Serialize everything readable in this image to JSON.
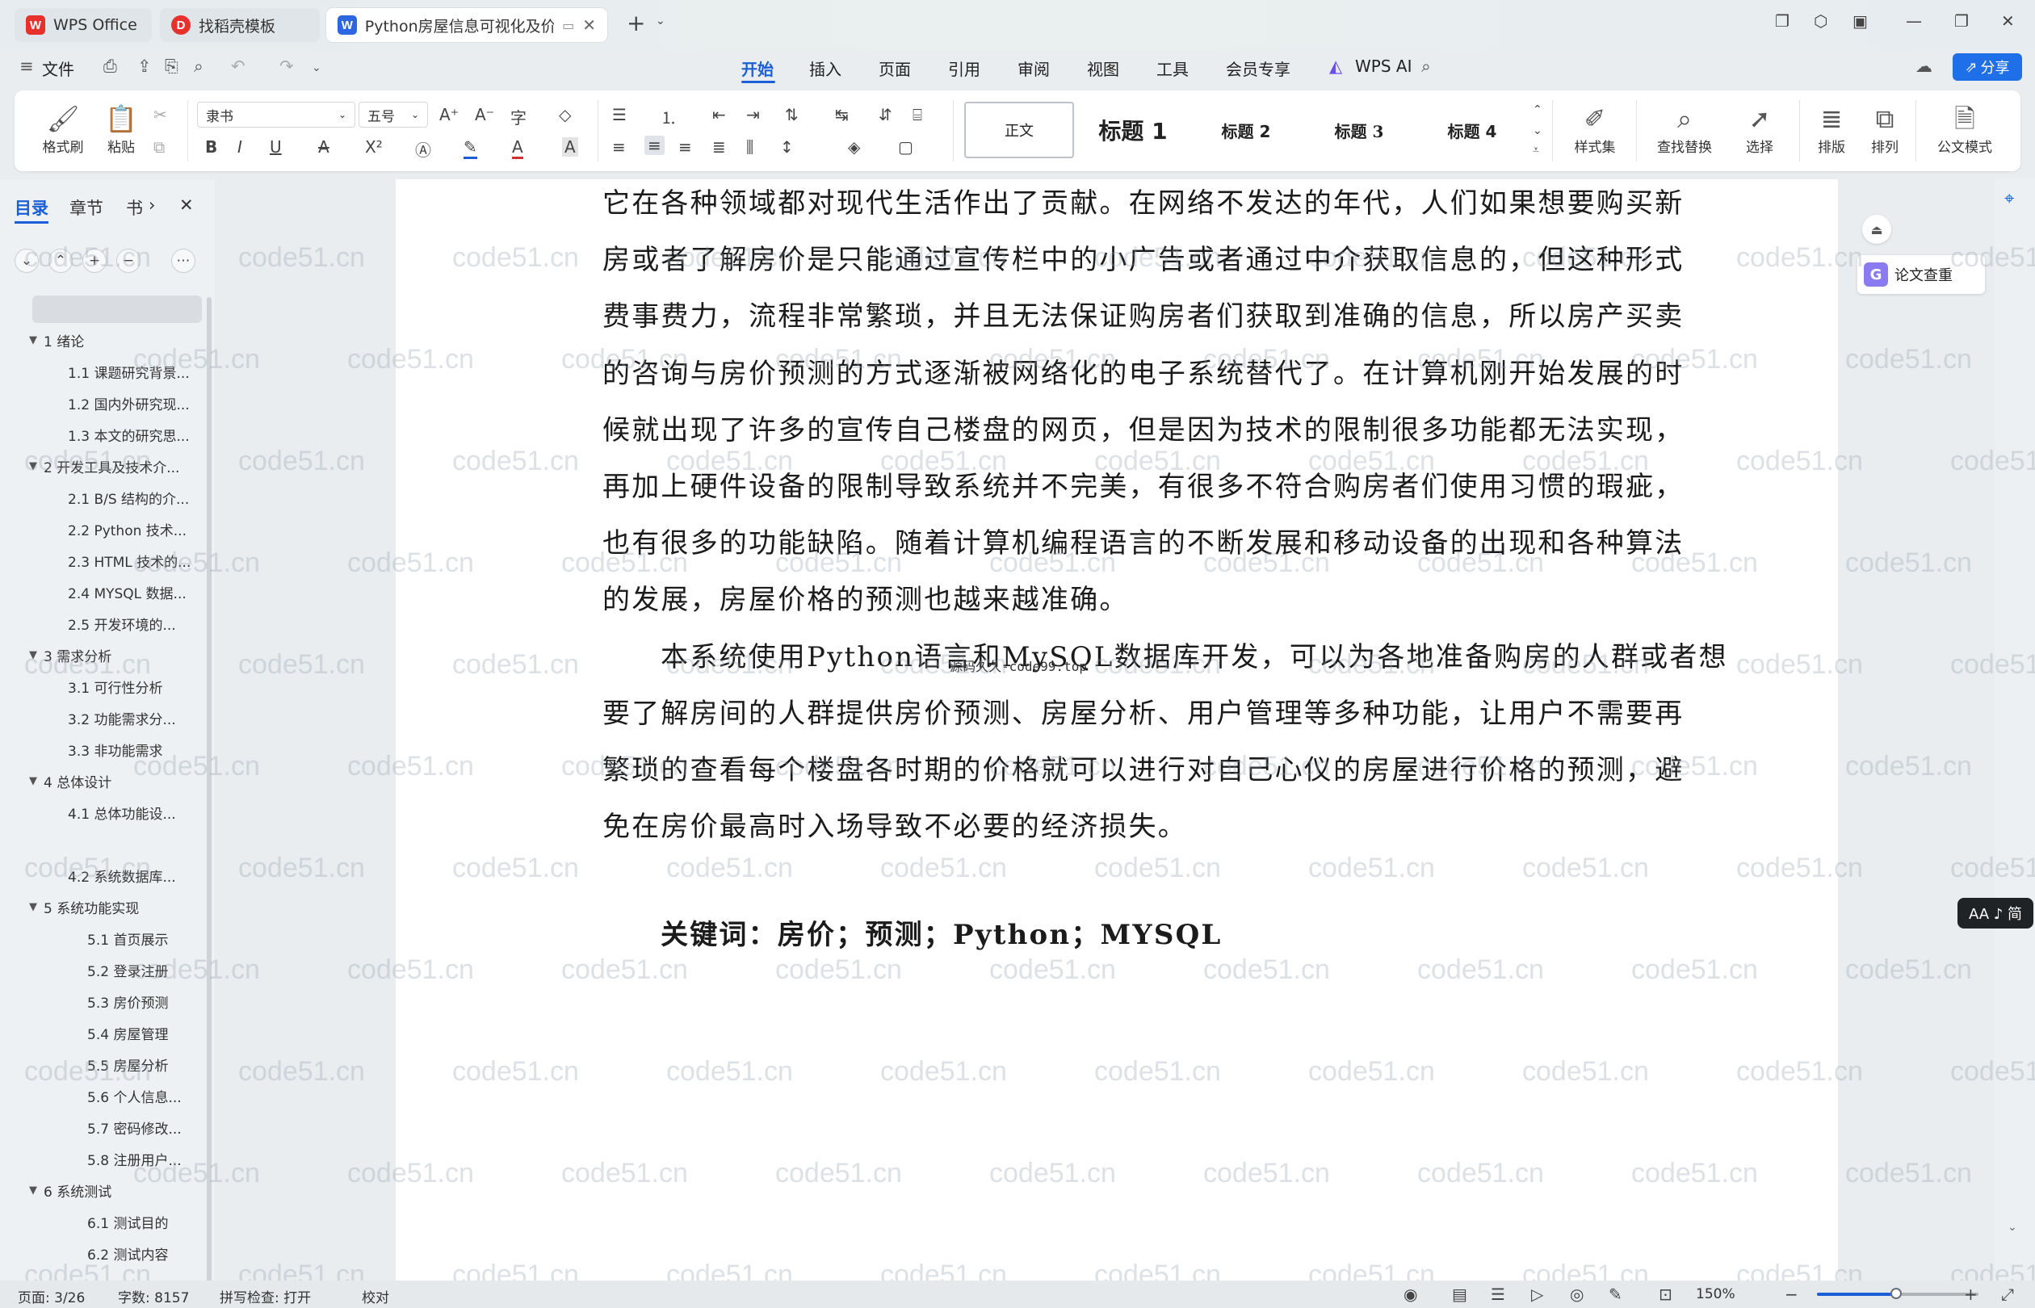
{
  "tabs": [
    {
      "label": "WPS Office",
      "logo": "W",
      "logo_color": "#e8302d"
    },
    {
      "label": "找稻壳模板",
      "logo": "D",
      "logo_color": "#e8302d"
    },
    {
      "label": "Python房屋信息可视化及价",
      "logo": "W",
      "logo_color": "#2c67e0"
    }
  ],
  "menu": {
    "file": "文件",
    "items": [
      "开始",
      "插入",
      "页面",
      "引用",
      "审阅",
      "视图",
      "工具",
      "会员专享"
    ],
    "active": "开始",
    "wps_ai": "WPS AI",
    "share": "分享"
  },
  "ribbon": {
    "format_painter": "格式刷",
    "paste": "粘贴",
    "font_name": "隶书",
    "font_size": "五号",
    "styles": [
      "正文",
      "标题 1",
      "标题 2",
      "标题 3",
      "标题 4"
    ],
    "style_set": "样式集",
    "find_replace": "查找替换",
    "select": "选择",
    "layout": "排版",
    "arrange": "排列",
    "official_mode": "公文模式"
  },
  "left_panel": {
    "tabs": [
      "目录",
      "章节",
      "书"
    ],
    "toc": [
      {
        "level": 1,
        "text": "1 绪论"
      },
      {
        "level": 2,
        "text": "1.1 课题研究背景..."
      },
      {
        "level": 2,
        "text": "1.2 国内外研究现..."
      },
      {
        "level": 2,
        "text": "1.3 本文的研究思..."
      },
      {
        "level": 1,
        "text": "2 开发工具及技术介..."
      },
      {
        "level": 2,
        "text": "2.1 B/S 结构的介..."
      },
      {
        "level": 2,
        "text": "2.2 Python 技术..."
      },
      {
        "level": 2,
        "text": "2.3 HTML 技术的..."
      },
      {
        "level": 2,
        "text": "2.4 MYSQL 数据..."
      },
      {
        "level": 2,
        "text": "2.5  开发环境的..."
      },
      {
        "level": 1,
        "text": "3 需求分析"
      },
      {
        "level": 2,
        "text": "3.1  可行性分析"
      },
      {
        "level": 2,
        "text": "3.2  功能需求分..."
      },
      {
        "level": 2,
        "text": "3.3  非功能需求"
      },
      {
        "level": 1,
        "text": "4 总体设计"
      },
      {
        "level": 2,
        "text": "4.1  总体功能设..."
      },
      {
        "level": 2,
        "text": "4.2  系统数据库..."
      },
      {
        "level": 1,
        "text": "5 系统功能实现"
      },
      {
        "level": 3,
        "text": "5.1  首页展示"
      },
      {
        "level": 3,
        "text": "5.2  登录注册"
      },
      {
        "level": 3,
        "text": "5.3  房价预测"
      },
      {
        "level": 3,
        "text": "5.4  房屋管理"
      },
      {
        "level": 3,
        "text": "5.5  房屋分析"
      },
      {
        "level": 3,
        "text": "5.6  个人信息..."
      },
      {
        "level": 3,
        "text": "5.7  密码修改..."
      },
      {
        "level": 3,
        "text": "5.8  注册用户..."
      },
      {
        "level": 1,
        "text": "6 系统测试"
      },
      {
        "level": 3,
        "text": "6.1  测试目的"
      },
      {
        "level": 3,
        "text": "6.2  测试内容"
      }
    ]
  },
  "document": {
    "lines": [
      "它在各种领域都对现代生活作出了贡献。在网络不发达的年代，人们如果想要购买新",
      "房或者了解房价是只能通过宣传栏中的小广告或者通过中介获取信息的，但这种形式",
      "费事费力，流程非常繁琐，并且无法保证购房者们获取到准确的信息，所以房产买卖",
      "的咨询与房价预测的方式逐渐被网络化的电子系统替代了。在计算机刚开始发展的时",
      "候就出现了许多的宣传自己楼盘的网页，但是因为技术的限制很多功能都无法实现，",
      "再加上硬件设备的限制导致系统并不完美，有很多不符合购房者们使用习惯的瑕疵，",
      "也有很多的功能缺陷。随着计算机编程语言的不断发展和移动设备的出现和各种算法",
      "的发展，房屋价格的预测也越来越准确。",
      "本系统使用Python语言和MySQL数据库开发，可以为各地准备购房的人群或者想",
      "要了解房间的人群提供房价预测、房屋分析、用户管理等多种功能，让用户不需要再",
      "繁琐的查看每个楼盘各时期的价格就可以进行对自己心仪的房屋进行价格的预测，避",
      "免在房价最高时入场导致不必要的经济损失。"
    ],
    "keywords": "关键词：房价；预测；Python；MYSQL",
    "inline_watermark": "源码久久-code99.top",
    "watermark_text": "code51.cn"
  },
  "right_tools": {
    "paper_check": "论文查重",
    "aa_badge": "AA ♪ 简"
  },
  "status": {
    "page": "页面: 3/26",
    "words": "字数: 8157",
    "spell": "拼写检查: 打开",
    "proof": "校对",
    "zoom": "150%",
    "zoom_level": 0.5
  }
}
